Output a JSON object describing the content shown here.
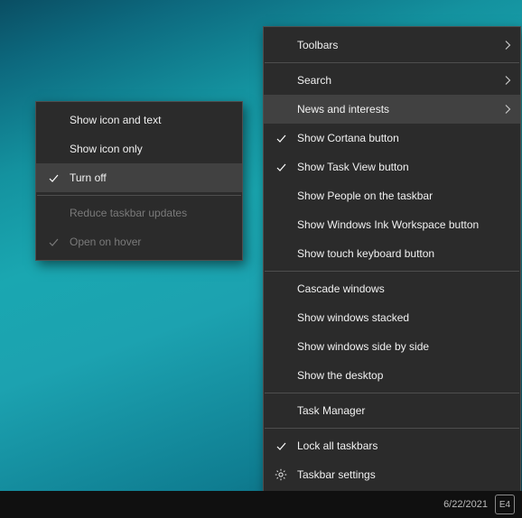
{
  "taskbar": {
    "date": "6/22/2021",
    "ime": "E4"
  },
  "main_menu": {
    "toolbars": "Toolbars",
    "search": "Search",
    "news": "News and interests",
    "cortana": "Show Cortana button",
    "taskview": "Show Task View button",
    "people": "Show People on the taskbar",
    "ink": "Show Windows Ink Workspace button",
    "touchkb": "Show touch keyboard button",
    "cascade": "Cascade windows",
    "stacked": "Show windows stacked",
    "sidebyside": "Show windows side by side",
    "showdesktop": "Show the desktop",
    "taskmgr": "Task Manager",
    "lock": "Lock all taskbars",
    "settings": "Taskbar settings"
  },
  "sub_menu": {
    "icon_text": "Show icon and text",
    "icon_only": "Show icon only",
    "turn_off": "Turn off",
    "reduce": "Reduce taskbar updates",
    "open_hover": "Open on hover"
  }
}
